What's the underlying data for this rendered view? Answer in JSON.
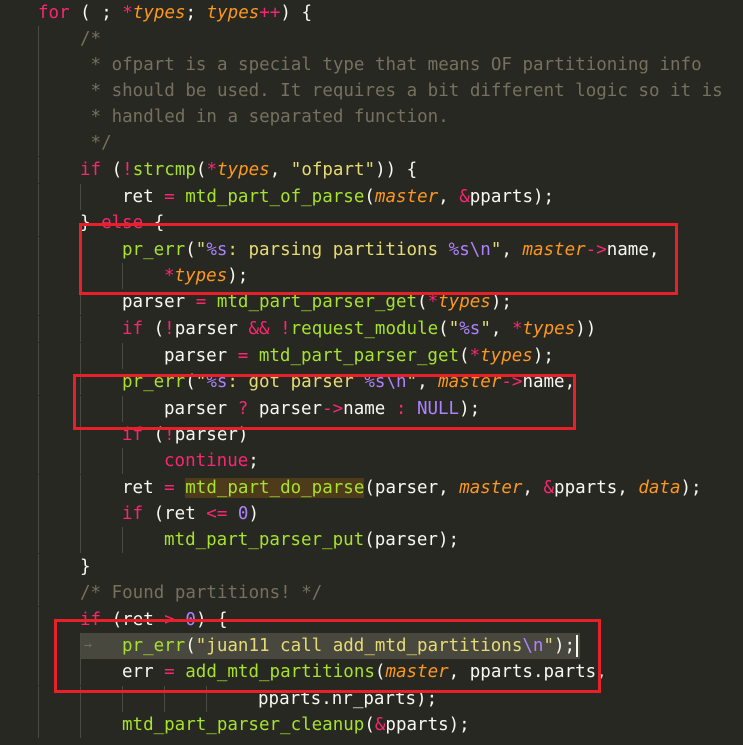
{
  "editor": {
    "theme_colors": {
      "background": "#272822",
      "keyword": "#f92672",
      "function": "#a6e22e",
      "parameter": "#fd971f",
      "string": "#e6db74",
      "constant": "#ae81ff",
      "comment": "#75715e",
      "annotation_box": "#e8202a"
    },
    "lines": [
      [
        {
          "t": "for",
          "c": "kw"
        },
        {
          "t": " ( ; ",
          "c": "plain"
        },
        {
          "t": "*",
          "c": "kw"
        },
        {
          "t": "types",
          "c": "param"
        },
        {
          "t": "; ",
          "c": "plain"
        },
        {
          "t": "types",
          "c": "param"
        },
        {
          "t": "++",
          "c": "kw"
        },
        {
          "t": ") {",
          "c": "plain"
        }
      ],
      [
        {
          "t": "/*",
          "c": "cm"
        }
      ],
      [
        {
          "t": " * ofpart is a special type that means OF partitioning info",
          "c": "cm"
        }
      ],
      [
        {
          "t": " * should be used. It requires a bit different logic so it is",
          "c": "cm"
        }
      ],
      [
        {
          "t": " * handled in a separated function.",
          "c": "cm"
        }
      ],
      [
        {
          "t": " */",
          "c": "cm"
        }
      ],
      [
        {
          "t": "if",
          "c": "kw"
        },
        {
          "t": " (",
          "c": "plain"
        },
        {
          "t": "!",
          "c": "kw"
        },
        {
          "t": "strcmp",
          "c": "fn"
        },
        {
          "t": "(",
          "c": "plain"
        },
        {
          "t": "*",
          "c": "kw"
        },
        {
          "t": "types",
          "c": "param"
        },
        {
          "t": ", ",
          "c": "plain"
        },
        {
          "t": "\"ofpart\"",
          "c": "str"
        },
        {
          "t": ")) {",
          "c": "plain"
        }
      ],
      [
        {
          "t": "ret ",
          "c": "plain"
        },
        {
          "t": "=",
          "c": "kw"
        },
        {
          "t": " ",
          "c": "plain"
        },
        {
          "t": "mtd_part_of_parse",
          "c": "fn"
        },
        {
          "t": "(",
          "c": "plain"
        },
        {
          "t": "master",
          "c": "param"
        },
        {
          "t": ", ",
          "c": "plain"
        },
        {
          "t": "&",
          "c": "kw"
        },
        {
          "t": "pparts);",
          "c": "plain"
        }
      ],
      [
        {
          "t": "} ",
          "c": "plain"
        },
        {
          "t": "else",
          "c": "kw"
        },
        {
          "t": " {",
          "c": "plain"
        }
      ],
      [
        {
          "t": "pr_err",
          "c": "fn"
        },
        {
          "t": "(",
          "c": "plain"
        },
        {
          "t": "\"",
          "c": "str"
        },
        {
          "t": "%s",
          "c": "const"
        },
        {
          "t": ": parsing partitions ",
          "c": "str"
        },
        {
          "t": "%s",
          "c": "const"
        },
        {
          "t": "\\n",
          "c": "esc"
        },
        {
          "t": "\"",
          "c": "str"
        },
        {
          "t": ", ",
          "c": "plain"
        },
        {
          "t": "master",
          "c": "param"
        },
        {
          "t": "->",
          "c": "kw"
        },
        {
          "t": "name,",
          "c": "plain"
        }
      ],
      [
        {
          "t": "*",
          "c": "kw"
        },
        {
          "t": "types",
          "c": "param"
        },
        {
          "t": ");",
          "c": "plain"
        }
      ],
      [
        {
          "t": "parser ",
          "c": "plain"
        },
        {
          "t": "=",
          "c": "kw"
        },
        {
          "t": " ",
          "c": "plain"
        },
        {
          "t": "mtd_part_parser_get",
          "c": "fn"
        },
        {
          "t": "(",
          "c": "plain"
        },
        {
          "t": "*",
          "c": "kw"
        },
        {
          "t": "types",
          "c": "param"
        },
        {
          "t": ");",
          "c": "plain"
        }
      ],
      [
        {
          "t": "if",
          "c": "kw"
        },
        {
          "t": " (",
          "c": "plain"
        },
        {
          "t": "!",
          "c": "kw"
        },
        {
          "t": "parser ",
          "c": "plain"
        },
        {
          "t": "&&",
          "c": "kw"
        },
        {
          "t": " ",
          "c": "plain"
        },
        {
          "t": "!",
          "c": "kw"
        },
        {
          "t": "request_module",
          "c": "fn"
        },
        {
          "t": "(",
          "c": "plain"
        },
        {
          "t": "\"",
          "c": "str"
        },
        {
          "t": "%s",
          "c": "const"
        },
        {
          "t": "\"",
          "c": "str"
        },
        {
          "t": ", ",
          "c": "plain"
        },
        {
          "t": "*",
          "c": "kw"
        },
        {
          "t": "types",
          "c": "param"
        },
        {
          "t": "))",
          "c": "plain"
        }
      ],
      [
        {
          "t": "parser ",
          "c": "plain"
        },
        {
          "t": "=",
          "c": "kw"
        },
        {
          "t": " ",
          "c": "plain"
        },
        {
          "t": "mtd_part_parser_get",
          "c": "fn"
        },
        {
          "t": "(",
          "c": "plain"
        },
        {
          "t": "*",
          "c": "kw"
        },
        {
          "t": "types",
          "c": "param"
        },
        {
          "t": ");",
          "c": "plain"
        }
      ],
      [
        {
          "t": "pr_err",
          "c": "fn"
        },
        {
          "t": "(",
          "c": "plain"
        },
        {
          "t": "\"",
          "c": "str"
        },
        {
          "t": "%s",
          "c": "const"
        },
        {
          "t": ": got parser ",
          "c": "str"
        },
        {
          "t": "%s",
          "c": "const"
        },
        {
          "t": "\\n",
          "c": "esc"
        },
        {
          "t": "\"",
          "c": "str"
        },
        {
          "t": ", ",
          "c": "plain"
        },
        {
          "t": "master",
          "c": "param"
        },
        {
          "t": "->",
          "c": "kw"
        },
        {
          "t": "name,",
          "c": "plain"
        }
      ],
      [
        {
          "t": "parser ",
          "c": "plain"
        },
        {
          "t": "?",
          "c": "kw"
        },
        {
          "t": " parser",
          "c": "plain"
        },
        {
          "t": "->",
          "c": "kw"
        },
        {
          "t": "name ",
          "c": "plain"
        },
        {
          "t": ":",
          "c": "kw"
        },
        {
          "t": " ",
          "c": "plain"
        },
        {
          "t": "NULL",
          "c": "const"
        },
        {
          "t": ");",
          "c": "plain"
        }
      ],
      [
        {
          "t": "if",
          "c": "kw"
        },
        {
          "t": " (",
          "c": "plain"
        },
        {
          "t": "!",
          "c": "kw"
        },
        {
          "t": "parser)",
          "c": "plain"
        }
      ],
      [
        {
          "t": "continue",
          "c": "kw"
        },
        {
          "t": ";",
          "c": "plain"
        }
      ],
      [
        {
          "t": "ret ",
          "c": "plain"
        },
        {
          "t": "=",
          "c": "kw"
        },
        {
          "t": " ",
          "c": "plain"
        },
        {
          "t": "mtd_part_do_parse",
          "c": "fn",
          "m": true
        },
        {
          "t": "(parser, ",
          "c": "plain"
        },
        {
          "t": "master",
          "c": "param"
        },
        {
          "t": ", ",
          "c": "plain"
        },
        {
          "t": "&",
          "c": "kw"
        },
        {
          "t": "pparts, ",
          "c": "plain"
        },
        {
          "t": "data",
          "c": "param"
        },
        {
          "t": ");",
          "c": "plain"
        }
      ],
      [
        {
          "t": "if",
          "c": "kw"
        },
        {
          "t": " (ret ",
          "c": "plain"
        },
        {
          "t": "<=",
          "c": "kw"
        },
        {
          "t": " ",
          "c": "plain"
        },
        {
          "t": "0",
          "c": "const"
        },
        {
          "t": ")",
          "c": "plain"
        }
      ],
      [
        {
          "t": "mtd_part_parser_put",
          "c": "fn"
        },
        {
          "t": "(parser);",
          "c": "plain"
        }
      ],
      [
        {
          "t": "}",
          "c": "plain"
        }
      ],
      [
        {
          "t": "/* Found partitions! */",
          "c": "cm"
        }
      ],
      [
        {
          "t": "if",
          "c": "kw"
        },
        {
          "t": " (ret ",
          "c": "plain"
        },
        {
          "t": ">",
          "c": "kw"
        },
        {
          "t": " ",
          "c": "plain"
        },
        {
          "t": "0",
          "c": "const"
        },
        {
          "t": ") {",
          "c": "plain"
        }
      ],
      [
        {
          "t": "pr_err",
          "c": "fn"
        },
        {
          "t": "(",
          "c": "plain"
        },
        {
          "t": "\"juan11 call add_mtd_partitions",
          "c": "str"
        },
        {
          "t": "\\n",
          "c": "esc"
        },
        {
          "t": "\"",
          "c": "str"
        },
        {
          "t": ");",
          "c": "plain"
        }
      ],
      [
        {
          "t": "err ",
          "c": "plain"
        },
        {
          "t": "=",
          "c": "kw"
        },
        {
          "t": " ",
          "c": "plain"
        },
        {
          "t": "add_mtd_partitions",
          "c": "fn"
        },
        {
          "t": "(",
          "c": "plain"
        },
        {
          "t": "master",
          "c": "param"
        },
        {
          "t": ", pparts.parts,",
          "c": "plain"
        }
      ],
      [
        {
          "t": "pparts.nr_parts);",
          "c": "plain"
        }
      ],
      [
        {
          "t": "mtd_part_parser_cleanup",
          "c": "fn"
        },
        {
          "t": "(",
          "c": "plain"
        },
        {
          "t": "&",
          "c": "kw"
        },
        {
          "t": "pparts);",
          "c": "plain"
        }
      ]
    ],
    "tab_arrow_icon": "→"
  }
}
